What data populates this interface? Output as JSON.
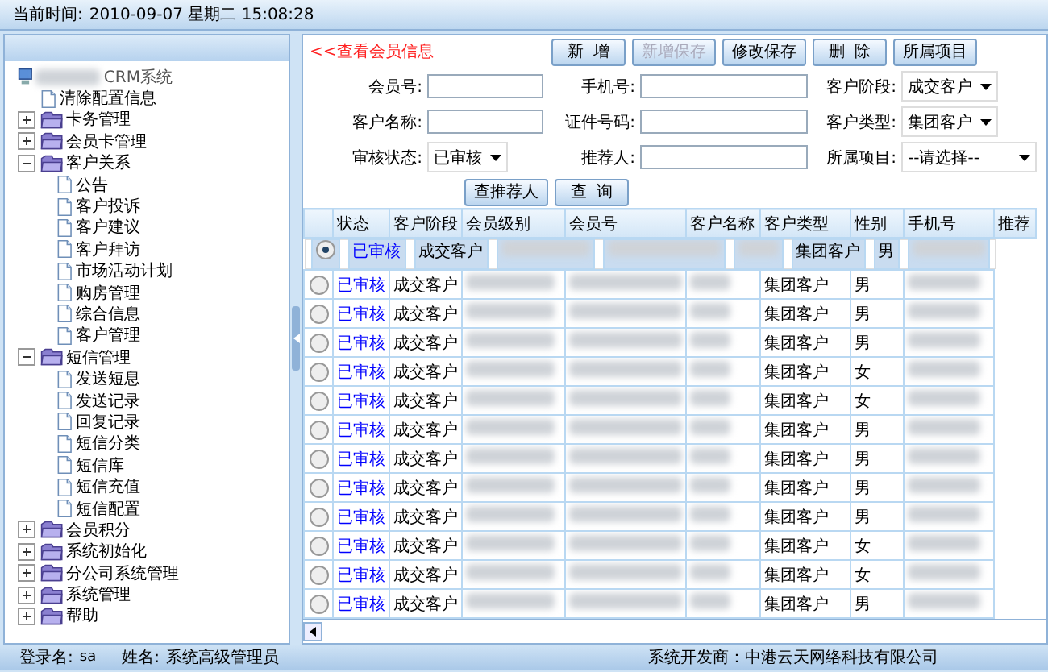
{
  "top_bar": {
    "label": "当前时间:",
    "datetime": "2010-09-07  星期二  15:08:28"
  },
  "tree": {
    "root": "CRM系统",
    "items": [
      {
        "label": "清除配置信息",
        "kind": "page"
      },
      {
        "label": "卡务管理",
        "kind": "folder",
        "expanded": false
      },
      {
        "label": "会员卡管理",
        "kind": "folder",
        "expanded": false
      },
      {
        "label": "客户关系",
        "kind": "folder",
        "expanded": true,
        "children": [
          {
            "label": "公告"
          },
          {
            "label": "客户投诉"
          },
          {
            "label": "客户建议"
          },
          {
            "label": "客户拜访"
          },
          {
            "label": "市场活动计划"
          },
          {
            "label": "购房管理"
          },
          {
            "label": "综合信息"
          },
          {
            "label": "客户管理"
          }
        ]
      },
      {
        "label": "短信管理",
        "kind": "folder",
        "expanded": true,
        "children": [
          {
            "label": "发送短息"
          },
          {
            "label": "发送记录"
          },
          {
            "label": "回复记录"
          },
          {
            "label": "短信分类"
          },
          {
            "label": "短信库"
          },
          {
            "label": "短信充值"
          },
          {
            "label": "短信配置"
          }
        ]
      },
      {
        "label": "会员积分",
        "kind": "folder",
        "expanded": false
      },
      {
        "label": "系统初始化",
        "kind": "folder",
        "expanded": false
      },
      {
        "label": "分公司系统管理",
        "kind": "folder",
        "expanded": false
      },
      {
        "label": "系统管理",
        "kind": "folder",
        "expanded": false
      },
      {
        "label": "帮助",
        "kind": "folder",
        "expanded": false
      }
    ]
  },
  "page_title": "<<查看会员信息",
  "toolbar": [
    {
      "label": "新  增",
      "disabled": false
    },
    {
      "label": "新增保存",
      "disabled": true
    },
    {
      "label": "修改保存",
      "disabled": false
    },
    {
      "label": "删  除",
      "disabled": false
    },
    {
      "label": "所属项目",
      "disabled": false
    }
  ],
  "form": [
    {
      "label": "会员号:",
      "kind": "text"
    },
    {
      "label": "手机号:",
      "kind": "text"
    },
    {
      "label": "客户阶段:",
      "kind": "select",
      "value": "成交客户"
    },
    {
      "label": "客户名称:",
      "kind": "text"
    },
    {
      "label": "证件号码:",
      "kind": "text"
    },
    {
      "label": "客户类型:",
      "kind": "select",
      "value": "集团客户"
    },
    {
      "label": "审核状态:",
      "kind": "select",
      "value": "已审核"
    },
    {
      "label": "推荐人:",
      "kind": "text"
    },
    {
      "label": "所属项目:",
      "kind": "select",
      "value": "--请选择--"
    }
  ],
  "search_buttons": [
    "查推荐人",
    "查  询"
  ],
  "table": {
    "columns": [
      "状态",
      "客户阶段",
      "会员级别",
      "会员号",
      "客户名称",
      "客户类型",
      "性别",
      "手机号",
      "推荐"
    ],
    "rows": [
      {
        "selected": true,
        "status": "已审核",
        "stage": "成交客户",
        "type": "集团客户",
        "gender": "男"
      },
      {
        "selected": false,
        "status": "已审核",
        "stage": "成交客户",
        "type": "集团客户",
        "gender": "男"
      },
      {
        "selected": false,
        "status": "已审核",
        "stage": "成交客户",
        "type": "集团客户",
        "gender": "男"
      },
      {
        "selected": false,
        "status": "已审核",
        "stage": "成交客户",
        "type": "集团客户",
        "gender": "男"
      },
      {
        "selected": false,
        "status": "已审核",
        "stage": "成交客户",
        "type": "集团客户",
        "gender": "女"
      },
      {
        "selected": false,
        "status": "已审核",
        "stage": "成交客户",
        "type": "集团客户",
        "gender": "女"
      },
      {
        "selected": false,
        "status": "已审核",
        "stage": "成交客户",
        "type": "集团客户",
        "gender": "男"
      },
      {
        "selected": false,
        "status": "已审核",
        "stage": "成交客户",
        "type": "集团客户",
        "gender": "男"
      },
      {
        "selected": false,
        "status": "已审核",
        "stage": "成交客户",
        "type": "集团客户",
        "gender": "男"
      },
      {
        "selected": false,
        "status": "已审核",
        "stage": "成交客户",
        "type": "集团客户",
        "gender": "男"
      },
      {
        "selected": false,
        "status": "已审核",
        "stage": "成交客户",
        "type": "集团客户",
        "gender": "女"
      },
      {
        "selected": false,
        "status": "已审核",
        "stage": "成交客户",
        "type": "集团客户",
        "gender": "女"
      },
      {
        "selected": false,
        "status": "已审核",
        "stage": "成交客户",
        "type": "集团客户",
        "gender": "男"
      }
    ]
  },
  "status_bar": {
    "login_label": "登录名:",
    "login": "sa",
    "name_label": "姓名:",
    "name": "系统高级管理员",
    "developer": "系统开发商：中港云天网络科技有限公司"
  }
}
